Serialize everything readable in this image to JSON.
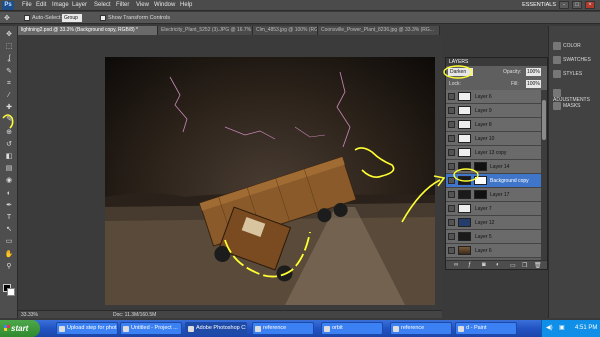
{
  "app": {
    "logo": "Ps",
    "menu": [
      "File",
      "Edit",
      "Image",
      "Layer",
      "Select",
      "Filter",
      "View",
      "Window",
      "Help"
    ],
    "workspace": "ESSENTIALS",
    "window_controls": [
      "-",
      "□",
      "×"
    ]
  },
  "options_bar": {
    "auto_select_label": "Auto-Select:",
    "auto_select_value": "Group",
    "show_transform_label": "Show Transform Controls"
  },
  "tabs": [
    {
      "label": "lightning2.psd @ 33.3% (Background copy, RGB/8) *",
      "active": true
    },
    {
      "label": "Electricity_Plant_5252 (3).JPG @ 16.7% (RG...",
      "active": false
    },
    {
      "label": "Clm_4853.jpg @ 100% (RG...",
      "active": false
    },
    {
      "label": "Coonsville_Power_Plant_8236.jpg @ 33.3% (RG...",
      "active": false
    }
  ],
  "tools": [
    "move-tool",
    "marquee-tool",
    "lasso-tool",
    "quick-select-tool",
    "crop-tool",
    "eyedropper-tool",
    "healing-tool",
    "brush-tool",
    "clone-stamp-tool",
    "history-brush-tool",
    "eraser-tool",
    "gradient-tool",
    "blur-tool",
    "dodge-tool",
    "pen-tool",
    "type-tool",
    "path-select-tool",
    "shape-tool",
    "hand-tool",
    "zoom-tool"
  ],
  "tool_glyphs": [
    "✥",
    "⬚",
    "ʆ",
    "✎",
    "⌗",
    "⁄",
    "✚",
    "✎",
    "⊕",
    "↺",
    "◧",
    "▤",
    "◉",
    "◐",
    "✒",
    "T",
    "↖",
    "▭",
    "✋",
    "⚲"
  ],
  "status": {
    "zoom": "33.33%",
    "doc": "Doc: 11.3M/160.5M"
  },
  "dock": [
    {
      "label": "COLOR",
      "icon": "color-icon"
    },
    {
      "label": "SWATCHES",
      "icon": "swatches-icon"
    },
    {
      "label": "STYLES",
      "icon": "styles-icon"
    },
    {
      "label": "ADJUSTMENTS",
      "icon": "adjustments-icon"
    },
    {
      "label": "MASKS",
      "icon": "masks-icon"
    }
  ],
  "layers_panel": {
    "title": "LAYERS",
    "blend_mode": "Darken",
    "opacity_label": "Opacity:",
    "opacity_value": "100%",
    "lock_label": "Lock:",
    "fill_label": "Fill:",
    "fill_value": "100%",
    "layers": [
      {
        "name": "Layer 6",
        "thumb": "white",
        "mask": "",
        "selected": false
      },
      {
        "name": "Layer 9",
        "thumb": "white",
        "mask": "",
        "selected": false
      },
      {
        "name": "Layer 8",
        "thumb": "white",
        "mask": "",
        "selected": false
      },
      {
        "name": "Layer 10",
        "thumb": "white",
        "mask": "",
        "selected": false
      },
      {
        "name": "Layer 13 copy",
        "thumb": "white",
        "mask": "",
        "selected": false
      },
      {
        "name": "Layer 14",
        "thumb": "dark",
        "mask": "dark",
        "selected": false
      },
      {
        "name": "Background copy",
        "thumb": "dark",
        "mask": "white",
        "selected": true
      },
      {
        "name": "Layer 17",
        "thumb": "dark",
        "mask": "dark",
        "selected": false
      },
      {
        "name": "Layer 7",
        "thumb": "white",
        "mask": "",
        "selected": false
      },
      {
        "name": "Layer 12",
        "thumb": "blue",
        "mask": "",
        "selected": false
      },
      {
        "name": "Layer 5",
        "thumb": "dark",
        "mask": "",
        "selected": false
      },
      {
        "name": "Layer 6",
        "thumb": "photo",
        "mask": "",
        "selected": false
      }
    ]
  },
  "taskbar": {
    "start": "start",
    "tasks": [
      {
        "label": "Upload step for phot...",
        "active": false
      },
      {
        "label": "Untitled - Project ...",
        "active": false
      },
      {
        "label": "Adobe Photoshop CS...",
        "active": true
      },
      {
        "label": "reference",
        "active": false
      },
      {
        "label": "orbit",
        "active": false
      },
      {
        "label": "reference",
        "active": false
      },
      {
        "label": "d - Paint",
        "active": false
      }
    ],
    "clock": "4:51 PM"
  },
  "colors": {
    "annotation": "#ffff33",
    "selected_layer": "#3f76c9"
  }
}
